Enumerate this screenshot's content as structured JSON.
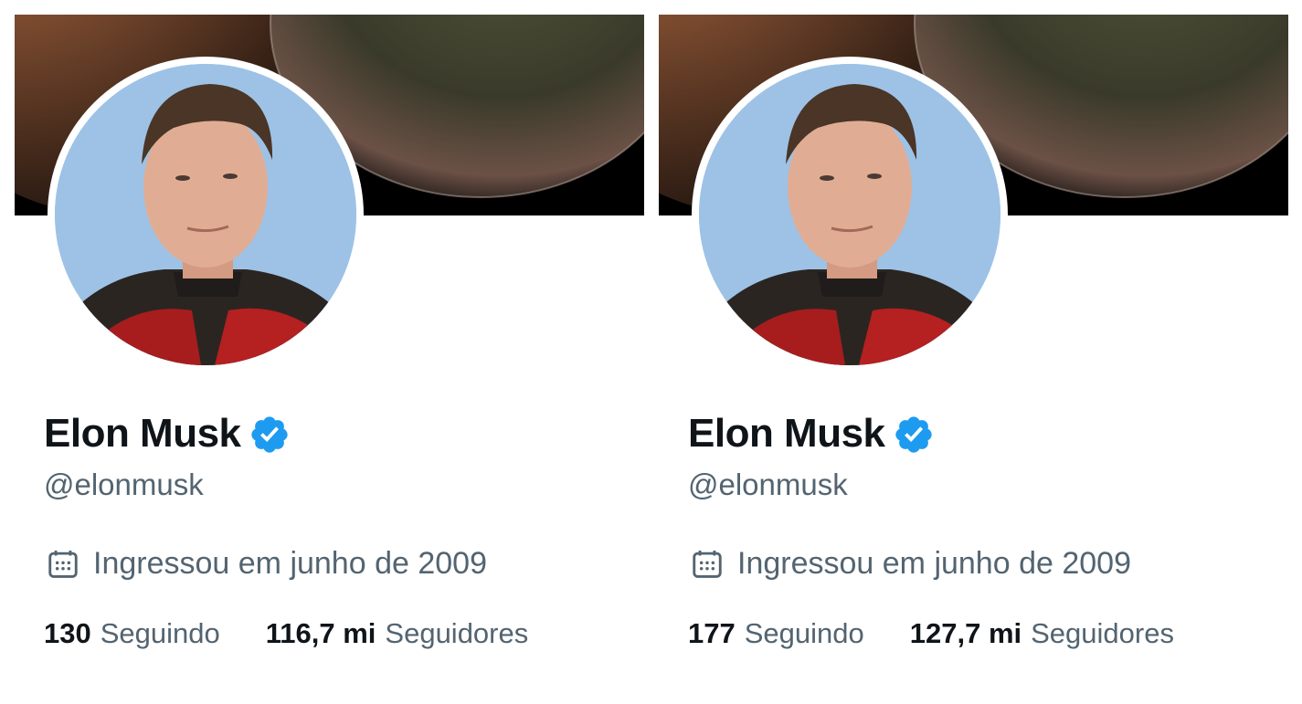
{
  "profiles": [
    {
      "name": "Elon Musk",
      "handle": "@elonmusk",
      "joined": "Ingressou em junho de 2009",
      "following": {
        "count": "130",
        "label": "Seguindo"
      },
      "followers": {
        "count": "116,7 mi",
        "label": "Seguidores"
      }
    },
    {
      "name": "Elon Musk",
      "handle": "@elonmusk",
      "joined": "Ingressou em junho de 2009",
      "following": {
        "count": "177",
        "label": "Seguindo"
      },
      "followers": {
        "count": "127,7 mi",
        "label": "Seguidores"
      }
    }
  ],
  "colors": {
    "verified_blue": "#1d9bf0",
    "text_primary": "#0f1419",
    "text_secondary": "#536471"
  },
  "icons": {
    "verified": "verified-badge-icon",
    "joined": "calendar-icon"
  }
}
